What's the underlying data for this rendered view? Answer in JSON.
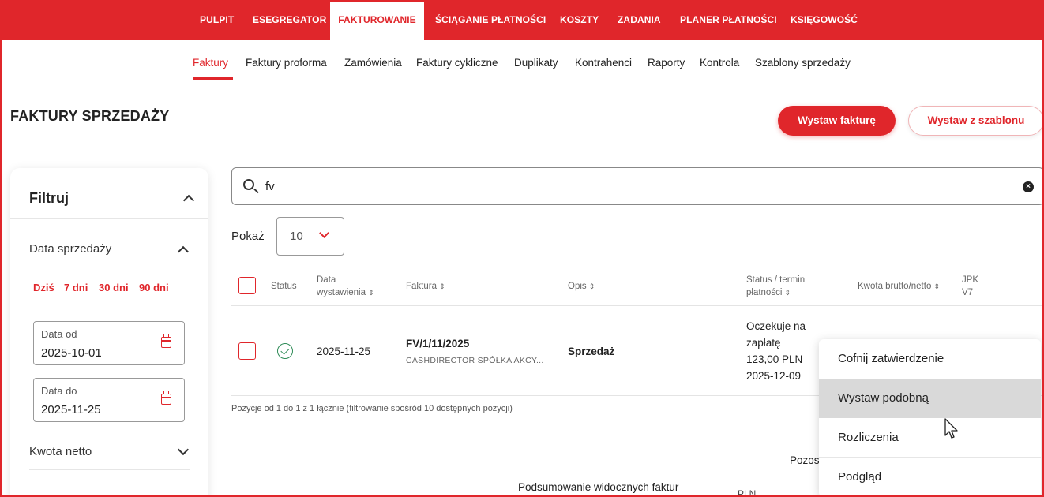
{
  "topnav": {
    "items": [
      "PULPIT",
      "ESEGREGATOR",
      "FAKTUROWANIE",
      "ŚCIĄGANIE PŁATNOŚCI",
      "KOSZTY",
      "ZADANIA",
      "PLANER PŁATNOŚCI",
      "KSIĘGOWOŚĆ"
    ],
    "active": "FAKTUROWANIE"
  },
  "subnav": {
    "items": [
      "Faktury",
      "Faktury proforma",
      "Zamówienia",
      "Faktury cykliczne",
      "Duplikaty",
      "Kontrahenci",
      "Raporty",
      "Kontrola",
      "Szablony sprzedaży"
    ],
    "active": "Faktury"
  },
  "page": {
    "title": "FAKTURY SPRZEDAŻY",
    "btn_issue": "Wystaw fakturę",
    "btn_template": "Wystaw z szablonu"
  },
  "filter": {
    "title": "Filtruj",
    "sale_date_label": "Data sprzedaży",
    "quick": [
      "Dziś",
      "7 dni",
      "30 dni",
      "90 dni"
    ],
    "date_from_label": "Data od",
    "date_from_value": "2025-10-01",
    "date_to_label": "Data do",
    "date_to_value": "2025-11-25",
    "net_amount_label": "Kwota netto"
  },
  "search": {
    "value": "fv"
  },
  "pagesize": {
    "label": "Pokaż",
    "value": "10"
  },
  "table": {
    "headers": {
      "status": "Status",
      "issue_date_1": "Data",
      "issue_date_2": "wystawienia",
      "invoice": "Faktura",
      "desc": "Opis",
      "payment_1": "Status / termin",
      "payment_2": "płatności",
      "amount": "Kwota brutto/netto",
      "jpk_1": "JPK",
      "jpk_2": "V7"
    },
    "rows": [
      {
        "date": "2025-11-25",
        "number": "FV/1/11/2025",
        "client": "CASHDIRECTOR SPÓŁKA AKCY...",
        "desc": "Sprzedaż",
        "pay_status_1": "Oczekuje na",
        "pay_status_2": "zapłatę",
        "pay_amount": "123,00 PLN",
        "pay_due": "2025-12-09"
      }
    ],
    "footer": "Pozycje od 1 do 1 z 1 łącznie (filtrowanie spośród 10 dostępnych pozycji)"
  },
  "summary": {
    "label": "Podsumowanie widocznych faktur",
    "pozos": "Pozos",
    "pln": "PLN"
  },
  "context_menu": {
    "items": [
      "Cofnij zatwierdzenie",
      "Wystaw podobną",
      "Rozliczenia",
      "Podgląd"
    ],
    "hovered": "Wystaw podobną"
  },
  "colors": {
    "brand": "#e0262b"
  }
}
